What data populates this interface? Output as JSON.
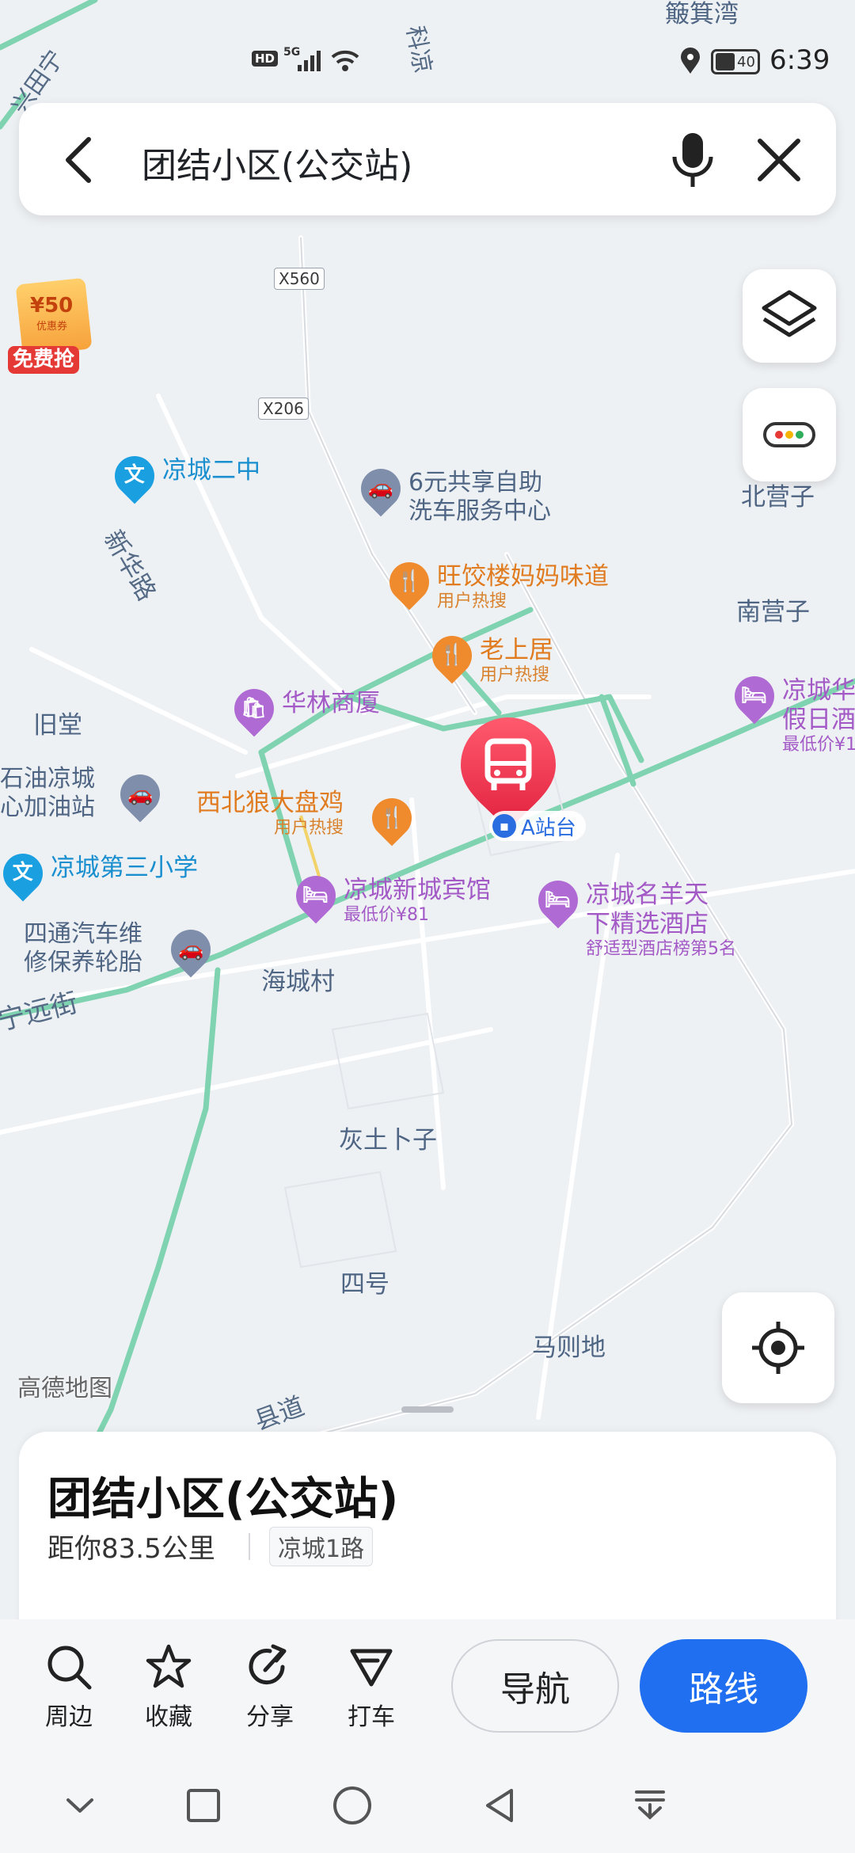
{
  "status_bar": {
    "network": "5G",
    "hd": "HD",
    "battery": "40",
    "time": "6:39"
  },
  "search": {
    "title": "团结小区(公交站)",
    "back_icon": "back-arrow-icon",
    "mic_icon": "microphone-icon",
    "close_icon": "close-icon"
  },
  "map": {
    "promo": {
      "amount": "¥50",
      "small": "优惠券",
      "text": "免费抢"
    },
    "shields": [
      "X560",
      "X206"
    ],
    "road_names": {
      "xinhua": "新华路",
      "ningyuan": "宁远街",
      "ke": "科凉",
      "xiantop": "兴田宁",
      "county": "县道"
    },
    "places": {
      "jiutang": "旧堂",
      "beiyingzi": "北营子",
      "nanyingzi": "南营子",
      "haichengcun": "海城村",
      "huitu": "灰土卜子",
      "sihao": "四号",
      "mazedi": "马则地",
      "jiji": "簸箕湾"
    },
    "pois": {
      "school2": "凉城二中",
      "school3": "凉城第三小学",
      "carwash_l1": "6元共享自助",
      "carwash_l2": "洗车服务中心",
      "wangjiao": "旺饺楼妈妈味道",
      "wangjiao_sub": "用户热搜",
      "laoshangju": "老上居",
      "laoshangju_sub": "用户热搜",
      "hualin": "华林商厦",
      "xibeilang": "西北狼大盘鸡",
      "xibeilang_sub": "用户热搜",
      "gas_l1": "石油凉城",
      "gas_l2": "心加油站",
      "sitong_l1": "四通汽车维",
      "sitong_l2": "修保养轮胎",
      "xincheng": "凉城新城宾馆",
      "xincheng_sub": "最低价¥81",
      "mingyang_l1": "凉城名羊天",
      "mingyang_l2": "下精选酒店",
      "mingyang_sub": "舒适型酒店榜第5名",
      "holiday_l1": "凉城华",
      "holiday_l2": "假日酒",
      "holiday_sub": "最低价¥1"
    },
    "stop_label": "A站台",
    "watermark": "高德地图"
  },
  "sheet": {
    "title": "团结小区(公交站)",
    "distance": "距你83.5公里",
    "route_tag": "凉城1路"
  },
  "actions": [
    {
      "label": "周边",
      "icon": "search-icon"
    },
    {
      "label": "收藏",
      "icon": "star-icon"
    },
    {
      "label": "分享",
      "icon": "share-icon"
    },
    {
      "label": "打车",
      "icon": "taxi-icon"
    }
  ],
  "buttons": {
    "navigate": "导航",
    "route": "路线"
  },
  "colors": {
    "primary": "#1f6ff0",
    "pin": "#e8243f",
    "road": "#7fd3b0"
  }
}
